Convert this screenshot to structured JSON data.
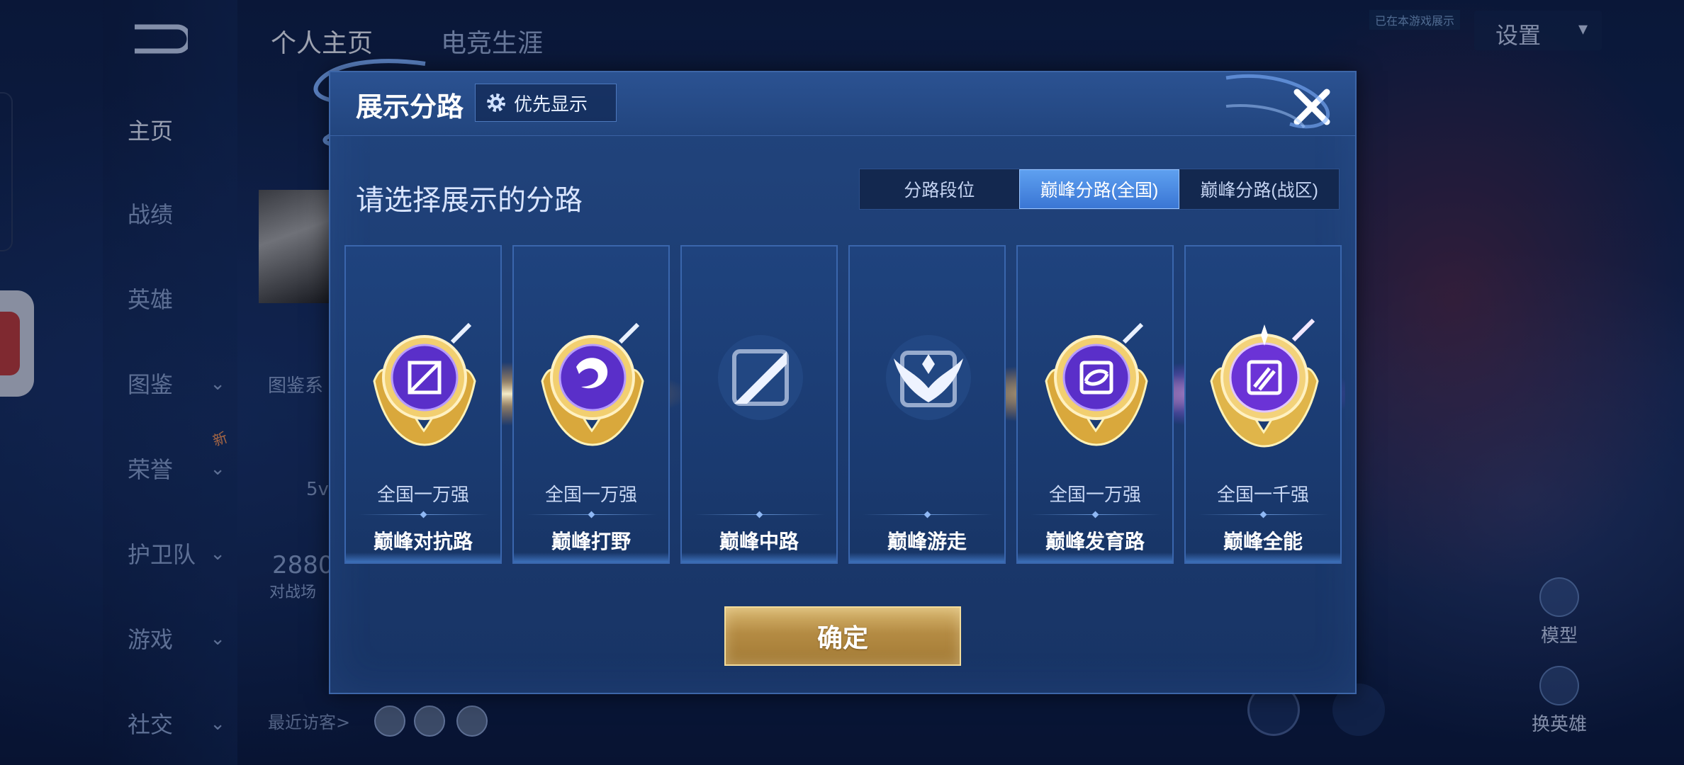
{
  "background": {
    "nav_items": [
      {
        "label": "主页",
        "active": true
      },
      {
        "label": "战绩"
      },
      {
        "label": "英雄"
      },
      {
        "label": "图鉴"
      },
      {
        "label": "荣誉"
      },
      {
        "label": "护卫队"
      },
      {
        "label": "游戏"
      },
      {
        "label": "社交"
      }
    ],
    "new_badge": "新",
    "top_tabs": [
      "个人主页",
      "电竞生涯"
    ],
    "settings_label": "设置",
    "online_note": "已在本游戏展示",
    "behind_texts": {
      "atlas": "图鉴系",
      "count": "5v",
      "score": "2880",
      "score_label": "对战场"
    },
    "recent_visitors_label": "最近访客>",
    "right_buttons": {
      "model": "模型",
      "change_hero": "换英雄"
    }
  },
  "modal": {
    "title": "展示分路",
    "priority_label": "优先显示",
    "subtitle": "请选择展示的分路",
    "tabs": [
      {
        "label": "分路段位",
        "active": false
      },
      {
        "label": "巅峰分路(全国)",
        "active": true
      },
      {
        "label": "巅峰分路(战区)",
        "active": false
      }
    ],
    "cards": [
      {
        "rank": "全国一万强",
        "lane": "巅峰对抗路",
        "badge": "gold"
      },
      {
        "rank": "全国一万强",
        "lane": "巅峰打野",
        "badge": "gold"
      },
      {
        "rank": "",
        "lane": "巅峰中路",
        "badge": "none"
      },
      {
        "rank": "",
        "lane": "巅峰游走",
        "badge": "none"
      },
      {
        "rank": "全国一万强",
        "lane": "巅峰发育路",
        "badge": "gold"
      },
      {
        "rank": "全国一千强",
        "lane": "巅峰全能",
        "badge": "gold-purple"
      }
    ],
    "confirm_label": "确定"
  },
  "colors": {
    "accent_blue": "#3a76d4",
    "confirm_gold": "#b48b43",
    "modal_bg": "#1c3c72"
  }
}
